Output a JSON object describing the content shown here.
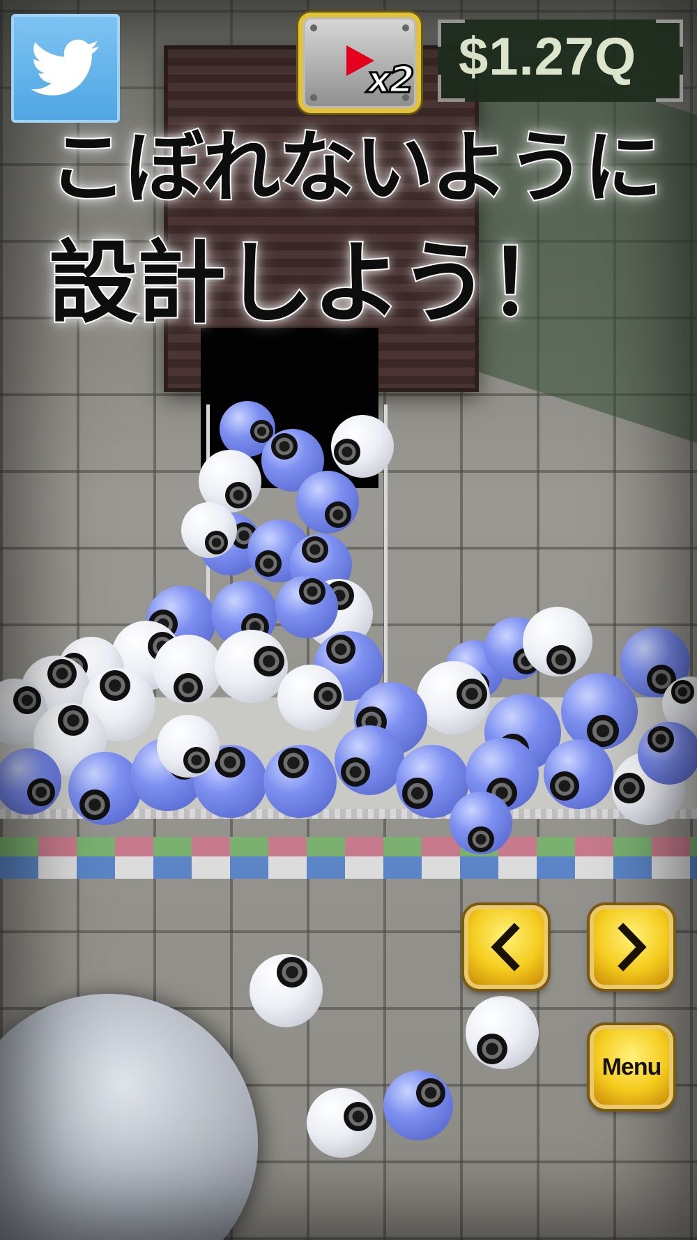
{
  "hud": {
    "video_boost_label": "x2",
    "money": "$1.27Q"
  },
  "headline": {
    "line1": "こぼれないように",
    "line2": "設計しよう！"
  },
  "controls": {
    "menu_label": "Menu"
  },
  "icons": {
    "share": "twitter-bird-icon",
    "video": "play-icon",
    "prev": "chevron-left-icon",
    "next": "chevron-right-icon"
  },
  "colors": {
    "twitter_blue": "#55acee",
    "gold_button": "#f5cc1e",
    "play_red": "#e4001c",
    "ball_blue": "#7d8ff0",
    "money_text": "#e8f0d6"
  }
}
